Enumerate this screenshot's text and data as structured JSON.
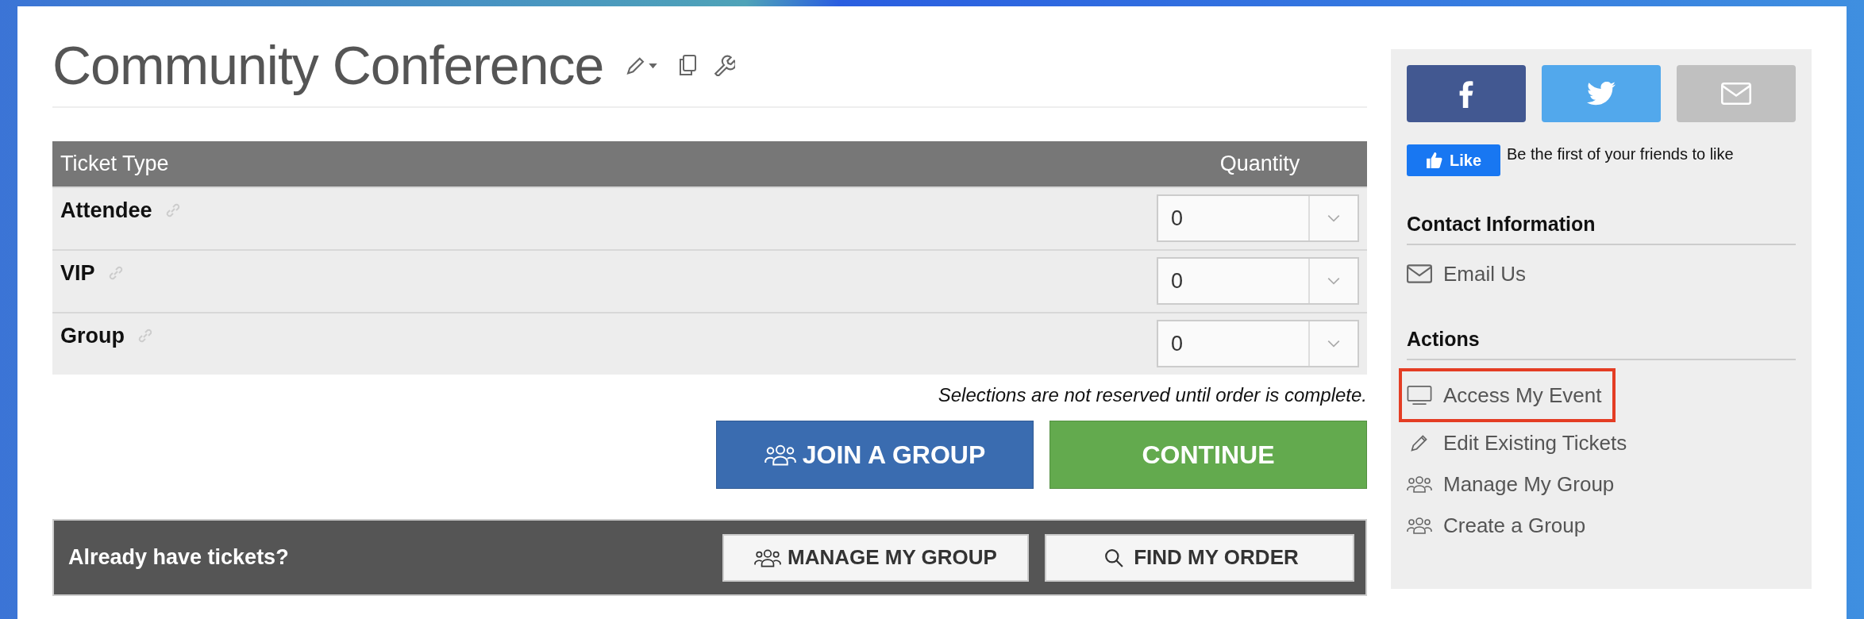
{
  "title": "Community Conference",
  "table": {
    "columns": [
      "Ticket Type",
      "Quantity"
    ],
    "rows": [
      {
        "name": "Attendee",
        "quantity": "0"
      },
      {
        "name": "VIP",
        "quantity": "0"
      },
      {
        "name": "Group",
        "quantity": "0"
      }
    ]
  },
  "note": "Selections are not reserved until order is complete.",
  "buttons": [
    {
      "kind": "join",
      "label": "JOIN A GROUP"
    },
    {
      "kind": "continue",
      "label": "CONTINUE"
    }
  ],
  "existing": {
    "label": "Already have tickets?",
    "buttons": [
      {
        "kind": "group",
        "label": "MANAGE MY GROUP"
      },
      {
        "kind": "search",
        "label": "FIND MY ORDER"
      }
    ]
  },
  "sidebar": {
    "share": [
      {
        "kind": "facebook"
      },
      {
        "kind": "twitter"
      },
      {
        "kind": "email"
      }
    ],
    "like": {
      "button": "Like",
      "text": "Be the first of your friends to like"
    },
    "sections": [
      {
        "heading": "Contact Information",
        "items": [
          {
            "kind": "email",
            "label": "Email Us",
            "highlighted": false
          }
        ]
      },
      {
        "heading": "Actions",
        "items": [
          {
            "kind": "screen",
            "label": "Access My Event",
            "highlighted": true
          },
          {
            "kind": "pencil",
            "label": "Edit Existing Tickets",
            "highlighted": false
          },
          {
            "kind": "group",
            "label": "Manage My Group",
            "highlighted": false
          },
          {
            "kind": "group",
            "label": "Create a Group",
            "highlighted": false
          }
        ]
      }
    ]
  }
}
